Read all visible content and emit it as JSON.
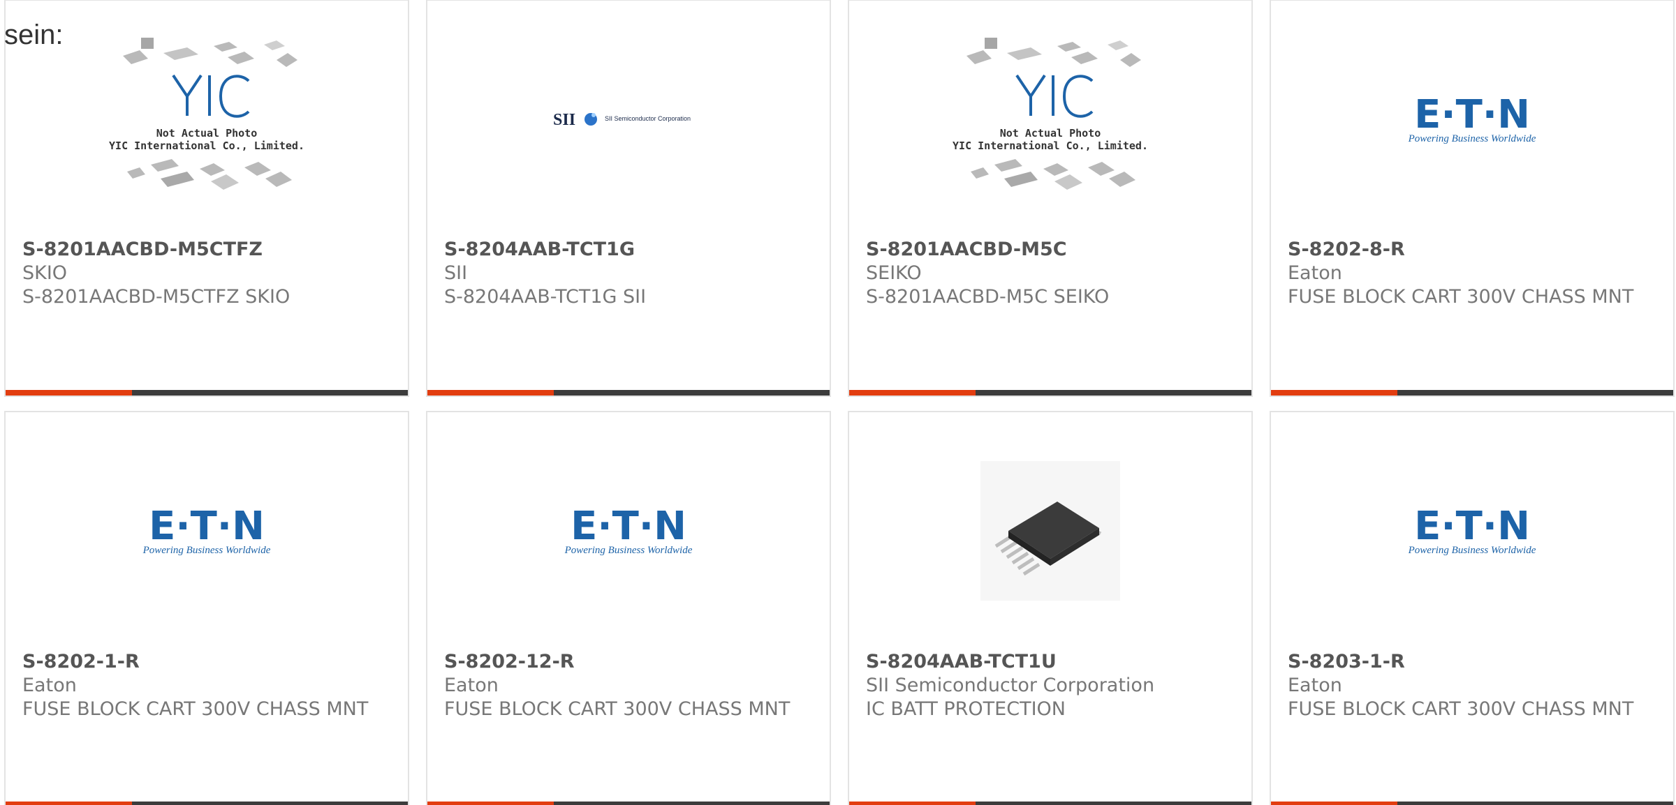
{
  "intro_text": "sein:",
  "colors": {
    "accent": "#e23d10",
    "bar": "#3c3c3c",
    "eaton_blue": "#1d63a8"
  },
  "products": [
    {
      "part_number": "S-8201AACBD-M5CTFZ",
      "manufacturer": "SKIO",
      "description": "S-8201AACBD-M5CTFZ SKIO",
      "image": "yic-placeholder",
      "image_text": [
        "Not Actual Photo",
        "YIC International Co., Limited."
      ]
    },
    {
      "part_number": "S-8204AAB-TCT1G",
      "manufacturer": "SII",
      "description": "S-8204AAB-TCT1G SII",
      "image": "sii-logo",
      "image_text": [
        "SII",
        "SII Semiconductor Corporation"
      ]
    },
    {
      "part_number": "S-8201AACBD-M5C",
      "manufacturer": "SEIKO",
      "description": "S-8201AACBD-M5C SEIKO",
      "image": "yic-placeholder",
      "image_text": [
        "Not Actual Photo",
        "YIC International Co., Limited."
      ]
    },
    {
      "part_number": "S-8202-8-R",
      "manufacturer": "Eaton",
      "description": "FUSE BLOCK CART 300V CHASS MNT",
      "image": "eaton-logo",
      "image_text": [
        "E·T·N",
        "Powering Business Worldwide"
      ]
    },
    {
      "part_number": "S-8202-1-R",
      "manufacturer": "Eaton",
      "description": "FUSE BLOCK CART 300V CHASS MNT",
      "image": "eaton-logo",
      "image_text": [
        "E·T·N",
        "Powering Business Worldwide"
      ]
    },
    {
      "part_number": "S-8202-12-R",
      "manufacturer": "Eaton",
      "description": "FUSE BLOCK CART 300V CHASS MNT",
      "image": "eaton-logo",
      "image_text": [
        "E·T·N",
        "Powering Business Worldwide"
      ]
    },
    {
      "part_number": "S-8204AAB-TCT1U",
      "manufacturer": "SII Semiconductor Corporation",
      "description": "IC BATT PROTECTION",
      "image": "chip-photo",
      "image_text": []
    },
    {
      "part_number": "S-8203-1-R",
      "manufacturer": "Eaton",
      "description": "FUSE BLOCK CART 300V CHASS MNT",
      "image": "eaton-logo",
      "image_text": [
        "E·T·N",
        "Powering Business Worldwide"
      ]
    }
  ]
}
